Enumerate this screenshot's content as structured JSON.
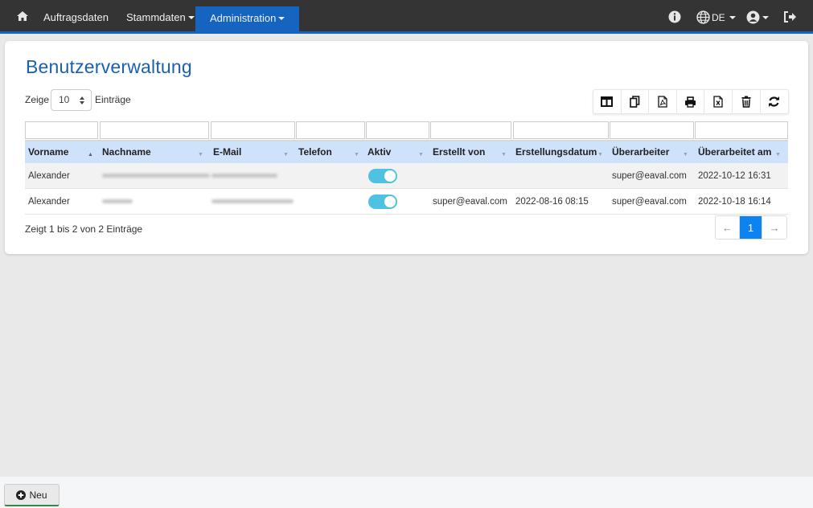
{
  "nav": {
    "home_icon": "home-icon",
    "items": [
      {
        "label": "Auftragsdaten",
        "dropdown": false
      },
      {
        "label": "Stammdaten",
        "dropdown": true
      },
      {
        "label": "Administration",
        "dropdown": true,
        "active": true
      }
    ],
    "language": "DE",
    "accent_color": "#1565c0",
    "bar_color": "#343434"
  },
  "page": {
    "title": "Benutzerverwaltung"
  },
  "length_menu": {
    "prefix": "Zeige",
    "value": "10",
    "suffix": "Einträge"
  },
  "toolbar": {
    "buttons": [
      "columns-icon",
      "copy-icon",
      "pdf-icon",
      "print-icon",
      "excel-icon",
      "delete-icon",
      "refresh-icon"
    ]
  },
  "table": {
    "columns": [
      "Vorname",
      "Nachname",
      "E-Mail",
      "Telefon",
      "Aktiv",
      "Erstellt von",
      "Erstellungsdatum",
      "Überarbeiter",
      "Überarbeitet am"
    ],
    "rows": [
      {
        "vorname": "Alexander",
        "nachname": "",
        "email": "",
        "telefon": "",
        "aktiv": true,
        "erstellt_von": "",
        "erstellungsdatum": "",
        "ueberarbeiter": "super@eaval.com",
        "ueberarbeitet_am": "2022-10-12 16:31"
      },
      {
        "vorname": "Alexander",
        "nachname": "",
        "email": "",
        "telefon": "",
        "aktiv": true,
        "erstellt_von": "super@eaval.com",
        "erstellungsdatum": "2022-08-16 08:15",
        "ueberarbeiter": "super@eaval.com",
        "ueberarbeitet_am": "2022-10-18 16:14"
      }
    ]
  },
  "footer_info": "Zeigt 1 bis 2 von 2 Einträge",
  "pagination": {
    "prev": "←",
    "current": "1",
    "next": "→"
  },
  "actions": {
    "new_label": "Neu"
  }
}
